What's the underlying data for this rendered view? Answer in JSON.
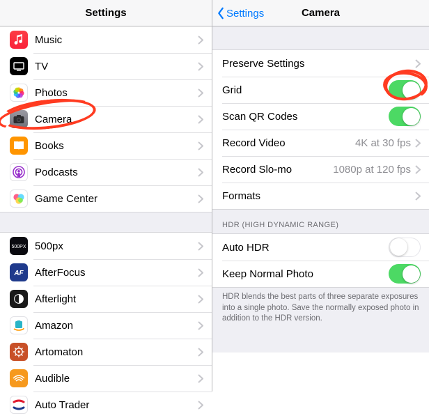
{
  "left": {
    "title": "Settings",
    "rows": [
      {
        "key": "music",
        "label": "Music"
      },
      {
        "key": "tv",
        "label": "TV"
      },
      {
        "key": "photos",
        "label": "Photos"
      },
      {
        "key": "camera",
        "label": "Camera"
      },
      {
        "key": "books",
        "label": "Books"
      },
      {
        "key": "podcasts",
        "label": "Podcasts"
      },
      {
        "key": "gamecenter",
        "label": "Game Center"
      }
    ],
    "rows2": [
      {
        "key": "500px",
        "label": "500px"
      },
      {
        "key": "afterfocus",
        "label": "AfterFocus"
      },
      {
        "key": "afterlight",
        "label": "Afterlight"
      },
      {
        "key": "amazon",
        "label": "Amazon"
      },
      {
        "key": "artomaton",
        "label": "Artomaton"
      },
      {
        "key": "audible",
        "label": "Audible"
      },
      {
        "key": "autotrader",
        "label": "Auto Trader"
      }
    ]
  },
  "right": {
    "back": "Settings",
    "title": "Camera",
    "preserve": "Preserve Settings",
    "grid": "Grid",
    "scanqr": "Scan QR Codes",
    "recordvideo": "Record Video",
    "recordvideo_val": "4K at 30 fps",
    "recordslomo": "Record Slo-mo",
    "recordslomo_val": "1080p at 120 fps",
    "formats": "Formats",
    "hdr_header": "HDR (HIGH DYNAMIC RANGE)",
    "autohdr": "Auto HDR",
    "keepnormal": "Keep Normal Photo",
    "hdr_footer": "HDR blends the best parts of three separate exposures into a single photo. Save the normally exposed photo in addition to the HDR version.",
    "toggles": {
      "grid": true,
      "scanqr": true,
      "autohdr": false,
      "keepnormal": true
    }
  },
  "icons": {
    "music": {
      "bg": "linear-gradient(#fc3c44,#fa233b)",
      "glyph": "♫",
      "fg": "#fff"
    },
    "tv": {
      "bg": "#000",
      "glyph": "",
      "fg": "#fff"
    },
    "photos": {
      "bg": "#fff",
      "glyph": "",
      "fg": ""
    },
    "camera": {
      "bg": "linear-gradient(#9b9ba4,#6f6f77)",
      "glyph": "",
      "fg": "#fff"
    },
    "books": {
      "bg": "#ff9500",
      "glyph": "",
      "fg": "#fff"
    },
    "podcasts": {
      "bg": "#fff",
      "glyph": "",
      "fg": "#9932cc"
    },
    "gamecenter": {
      "bg": "#fff",
      "glyph": "",
      "fg": ""
    },
    "500px": {
      "bg": "#0a0a10",
      "glyph": "500",
      "fg": "#fff"
    },
    "afterfocus": {
      "bg": "#1f3a8c",
      "glyph": "AF",
      "fg": "#fff"
    },
    "afterlight": {
      "bg": "#1a1a1a",
      "glyph": "",
      "fg": "#fff"
    },
    "amazon": {
      "bg": "#fff",
      "glyph": "",
      "fg": ""
    },
    "artomaton": {
      "bg": "#c85028",
      "glyph": "",
      "fg": "#fff"
    },
    "audible": {
      "bg": "#f6991e",
      "glyph": "",
      "fg": "#fff"
    },
    "autotrader": {
      "bg": "#fff",
      "glyph": "",
      "fg": ""
    }
  }
}
